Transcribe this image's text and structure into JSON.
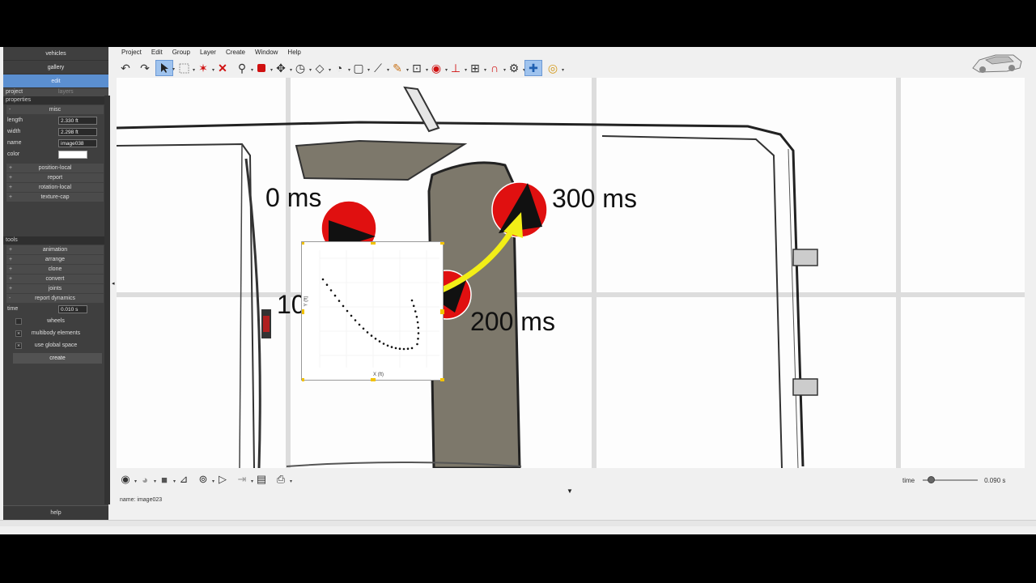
{
  "left_panel": {
    "nav": [
      "vehicles",
      "gallery",
      "edit"
    ],
    "subtabs": [
      "project",
      "layers"
    ],
    "properties_header": "properties",
    "misc_label": "misc",
    "props": [
      {
        "label": "length",
        "value": "2.330 ft"
      },
      {
        "label": "width",
        "value": "2.298 ft"
      },
      {
        "label": "name",
        "value": "image038"
      },
      {
        "label": "color",
        "value": ""
      }
    ],
    "groups": [
      "position-local",
      "report",
      "rotation-local",
      "texture-cap"
    ],
    "tools_header": "tools",
    "tools": [
      "animation",
      "arrange",
      "clone",
      "convert",
      "joints",
      "report dynamics"
    ],
    "time_label": "time",
    "time_value": "0.010 s",
    "wheels_label": "wheels",
    "multibody_label": "multibody elements",
    "global_label": "use global space",
    "create_label": "create",
    "help_label": "help"
  },
  "menu": [
    "Project",
    "Edit",
    "Group",
    "Layer",
    "Create",
    "Window",
    "Help"
  ],
  "canvas": {
    "labels": [
      "0 ms",
      "300 ms",
      "200 ms",
      "10"
    ],
    "overlay_xlabel": "X (ft)",
    "overlay_ylabel": "Y (ft)",
    "marker_color": "#e01010",
    "arrow_color": "#f2ee17",
    "window_color": "#7d786b"
  },
  "bottom": {
    "status_text": "name: image023",
    "time_label": "time",
    "time_value": "0.090 s",
    "slider_fraction": 0.09
  },
  "icons": {
    "toolbar": [
      "undo-icon",
      "redo-icon",
      "select-arrow-icon",
      "rectangle-select-icon",
      "node-edit-icon",
      "delete-icon",
      "zoom-icon",
      "shape-icon",
      "pan-icon",
      "rotate-icon",
      "polygon-icon",
      "measure-icon",
      "frame-icon",
      "line-icon",
      "pencil-icon",
      "insert-icon",
      "target-icon",
      "axes-icon",
      "align-icon",
      "magnet-icon",
      "gear-icon",
      "grid-icon",
      "help-icon"
    ]
  }
}
